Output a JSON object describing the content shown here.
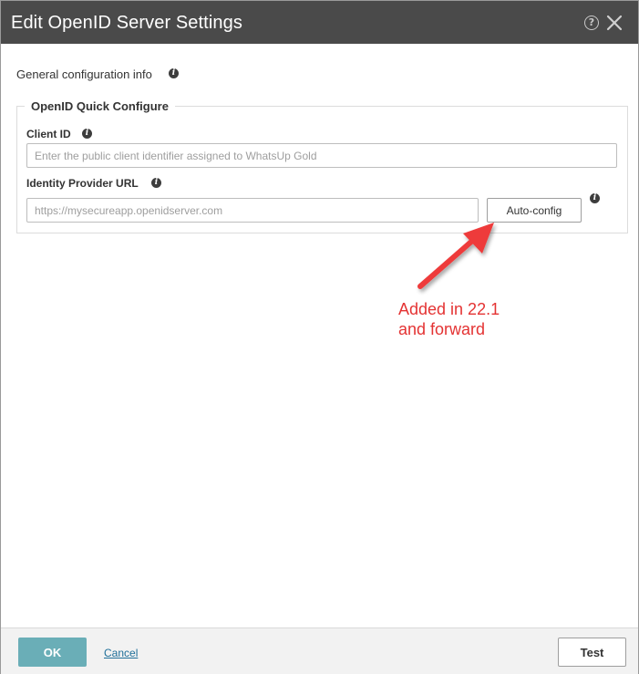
{
  "dialog": {
    "title": "Edit OpenID Server Settings",
    "help_icon": "question-circle-icon",
    "close_icon": "close-x-icon"
  },
  "general": {
    "label": "General configuration info",
    "info_icon": "info-icon"
  },
  "quick_configure": {
    "legend": "OpenID Quick Configure",
    "client_id": {
      "label": "Client ID",
      "value": "",
      "placeholder": "Enter the public client identifier assigned to WhatsUp Gold"
    },
    "identity_provider_url": {
      "label": "Identity Provider URL",
      "value": "",
      "placeholder": "https://mysecureapp.openidserver.com"
    },
    "auto_config_label": "Auto-config"
  },
  "annotation": {
    "line1": "Added in 22.1",
    "line2": "and forward",
    "color": "#e43333"
  },
  "footer": {
    "ok_label": "OK",
    "cancel_label": "Cancel",
    "test_label": "Test"
  },
  "colors": {
    "titlebar": "#4a4a4a",
    "ok_button": "#6aaeb7",
    "link": "#1f6f99"
  }
}
